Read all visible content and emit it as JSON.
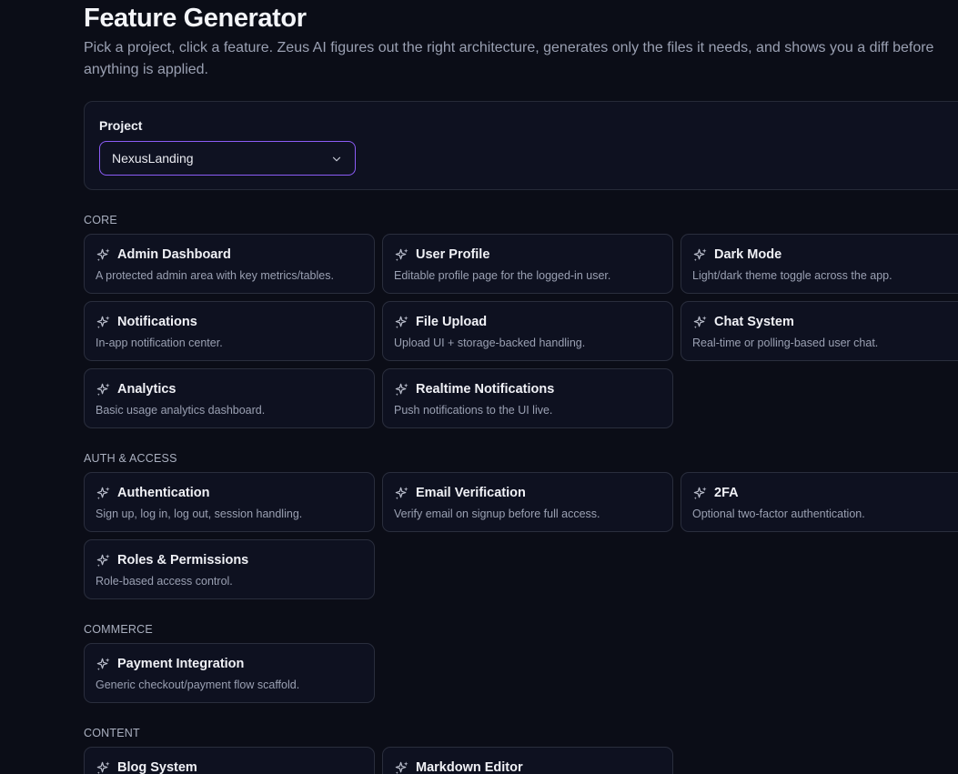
{
  "header": {
    "title": "Feature Generator",
    "subtitle": "Pick a project, click a feature. Zeus AI figures out the right architecture, generates only the files it needs, and shows you a diff before anything is applied."
  },
  "project": {
    "label": "Project",
    "selected": "NexusLanding"
  },
  "sections": {
    "core": {
      "label": "CORE",
      "cards": [
        {
          "title": "Admin Dashboard",
          "desc": "A protected admin area with key metrics/tables."
        },
        {
          "title": "User Profile",
          "desc": "Editable profile page for the logged-in user."
        },
        {
          "title": "Dark Mode",
          "desc": "Light/dark theme toggle across the app."
        },
        {
          "title": "Notifications",
          "desc": "In-app notification center."
        },
        {
          "title": "File Upload",
          "desc": "Upload UI + storage-backed handling."
        },
        {
          "title": "Chat System",
          "desc": "Real-time or polling-based user chat."
        },
        {
          "title": "Analytics",
          "desc": "Basic usage analytics dashboard."
        },
        {
          "title": "Realtime Notifications",
          "desc": "Push notifications to the UI live."
        }
      ]
    },
    "auth": {
      "label": "AUTH & ACCESS",
      "cards": [
        {
          "title": "Authentication",
          "desc": "Sign up, log in, log out, session handling."
        },
        {
          "title": "Email Verification",
          "desc": "Verify email on signup before full access."
        },
        {
          "title": "2FA",
          "desc": "Optional two-factor authentication."
        },
        {
          "title": "Roles & Permissions",
          "desc": "Role-based access control."
        }
      ]
    },
    "commerce": {
      "label": "COMMERCE",
      "cards": [
        {
          "title": "Payment Integration",
          "desc": "Generic checkout/payment flow scaffold."
        }
      ]
    },
    "content": {
      "label": "CONTENT",
      "cards": [
        {
          "title": "Blog System",
          "desc": ""
        },
        {
          "title": "Markdown Editor",
          "desc": ""
        }
      ]
    }
  },
  "icons": {
    "card_icon": "sparkles-icon",
    "select_icon": "chevron-down-icon"
  },
  "colors": {
    "background": "#0b0d17",
    "card_border": "#2a2e3d",
    "accent": "#8b5cf6",
    "muted_text": "#9aa0b2"
  }
}
